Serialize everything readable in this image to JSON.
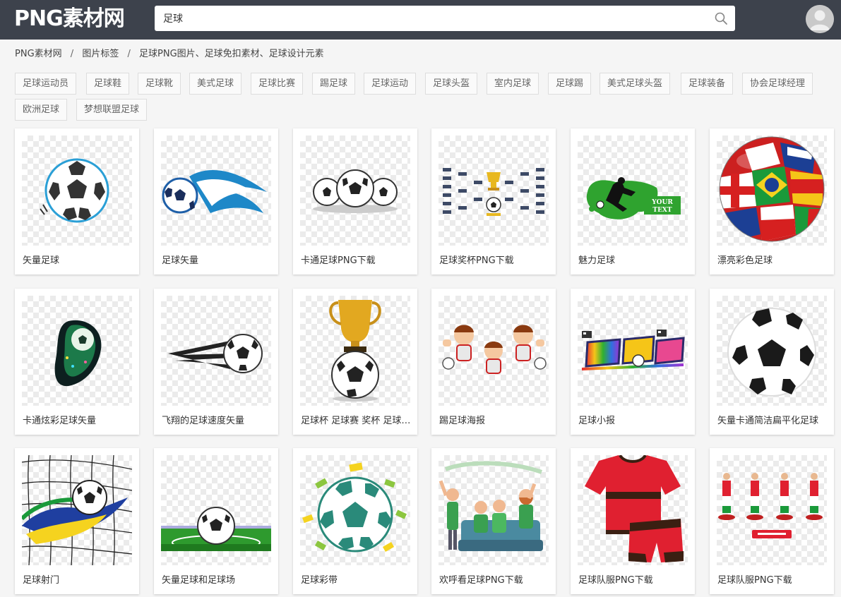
{
  "header": {
    "logo_text": "PNG素材网",
    "search_value": "足球",
    "search_icon": "search-icon",
    "avatar_icon": "user-avatar-icon"
  },
  "breadcrumb": {
    "home": "PNG素材网",
    "section": "图片标签",
    "current": "足球PNG图片、足球免扣素材、足球设计元素",
    "separator": "/"
  },
  "tags": [
    "足球运动员",
    "足球鞋",
    "足球靴",
    "美式足球",
    "足球比赛",
    "踢足球",
    "足球运动",
    "足球头盔",
    "室内足球",
    "足球踢",
    "美式足球头盔",
    "足球装备",
    "协会足球经理",
    "欧洲足球",
    "梦想联盟足球"
  ],
  "cards": [
    {
      "title": "矢量足球",
      "icon": "soccer-ball-icon"
    },
    {
      "title": "足球矢量",
      "icon": "flaming-soccer-ball-icon"
    },
    {
      "title": "卡通足球PNG下载",
      "icon": "three-soccer-balls-icon"
    },
    {
      "title": "足球奖杯PNG下载",
      "icon": "tournament-bracket-icon"
    },
    {
      "title": "魅力足球",
      "icon": "player-splash-icon"
    },
    {
      "title": "漂亮彩色足球",
      "icon": "flag-ball-icon"
    },
    {
      "title": "卡通炫彩足球矢量",
      "icon": "colorful-ball-icon"
    },
    {
      "title": "飞翔的足球速度矢量",
      "icon": "speed-ball-icon"
    },
    {
      "title": "足球杯 足球赛 奖杯 足球 比赛",
      "icon": "trophy-ball-icon"
    },
    {
      "title": "踢足球海报",
      "icon": "cartoon-kids-icon"
    },
    {
      "title": "足球小报",
      "icon": "soccer-title-icon"
    },
    {
      "title": "矢量卡通简洁扁平化足球",
      "icon": "large-soccer-ball-icon"
    },
    {
      "title": "足球射门",
      "icon": "goal-net-icon"
    },
    {
      "title": "矢量足球和足球场",
      "icon": "ball-on-field-icon"
    },
    {
      "title": "足球彩带",
      "icon": "ball-confetti-icon"
    },
    {
      "title": "欢呼看足球PNG下载",
      "icon": "cheering-fans-icon"
    },
    {
      "title": "足球队服PNG下载",
      "icon": "jersey-icon"
    },
    {
      "title": "足球队服PNG下载",
      "icon": "table-football-icon"
    }
  ],
  "colors": {
    "topbar": "#3d424c",
    "page_bg": "#f5f5f5",
    "tag_border": "#dddddd"
  }
}
